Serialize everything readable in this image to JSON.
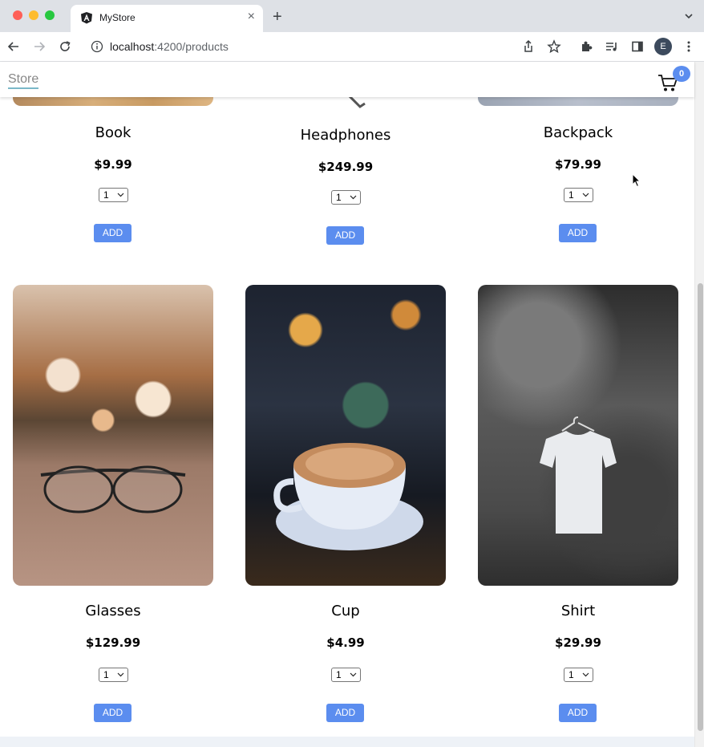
{
  "browser": {
    "tab_title": "MyStore",
    "url_host": "localhost",
    "url_path": ":4200/products",
    "profile_initial": "E"
  },
  "header": {
    "store_label": "Store",
    "cart_count": "0"
  },
  "products": [
    {
      "name": "Book",
      "price": "$9.99",
      "qty": "1",
      "add": "ADD"
    },
    {
      "name": "Headphones",
      "price": "$249.99",
      "qty": "1",
      "add": "ADD"
    },
    {
      "name": "Backpack",
      "price": "$79.99",
      "qty": "1",
      "add": "ADD"
    },
    {
      "name": "Glasses",
      "price": "$129.99",
      "qty": "1",
      "add": "ADD"
    },
    {
      "name": "Cup",
      "price": "$4.99",
      "qty": "1",
      "add": "ADD"
    },
    {
      "name": "Shirt",
      "price": "$29.99",
      "qty": "1",
      "add": "ADD"
    }
  ],
  "colors": {
    "accent": "#5b8def",
    "tabbar": "#dee1e6"
  }
}
